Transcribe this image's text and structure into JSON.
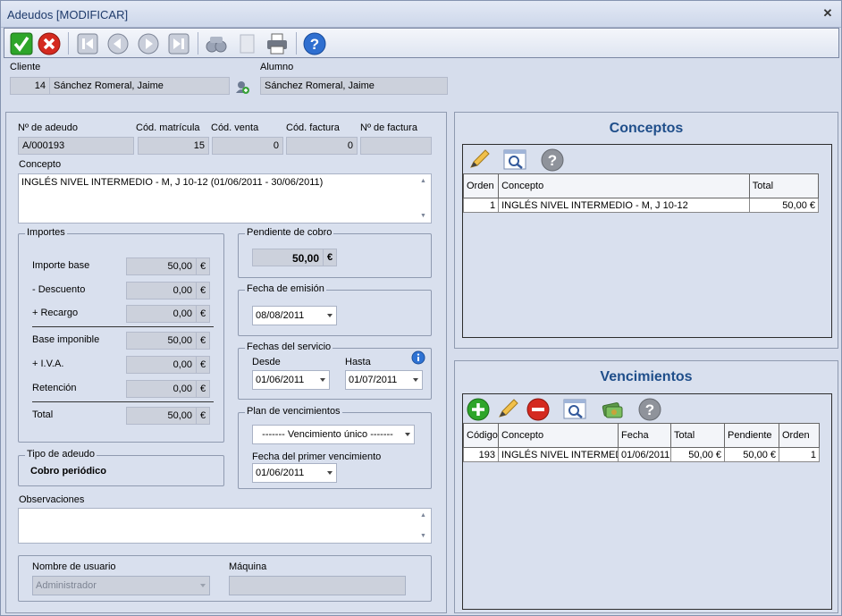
{
  "window": {
    "title": "Adeudos [MODIFICAR]"
  },
  "toolbar": {
    "buttons": [
      "accept-icon",
      "cancel-icon",
      "first-record-icon",
      "previous-record-icon",
      "next-record-icon",
      "last-record-icon",
      "search-binoculars-icon",
      "document-icon",
      "print-icon",
      "help-icon"
    ]
  },
  "cliente": {
    "label": "Cliente",
    "code": "14",
    "name": "Sánchez Romeral, Jaime"
  },
  "alumno": {
    "label": "Alumno",
    "name": "Sánchez Romeral, Jaime"
  },
  "adeudo": {
    "num_label": "Nº de adeudo",
    "num": "A/000193",
    "matricula_label": "Cód. matrícula",
    "matricula": "15",
    "venta_label": "Cód. venta",
    "venta": "0",
    "factura_label": "Cód. factura",
    "factura": "0",
    "nfactura_label": "Nº de factura",
    "nfactura": "",
    "concepto_label": "Concepto",
    "concepto": "INGLÉS NIVEL INTERMEDIO - M, J 10-12 (01/06/2011 - 30/06/2011)"
  },
  "importes": {
    "title": "Importes",
    "currency": "€",
    "rows": [
      {
        "label": "Importe base",
        "value": "50,00"
      },
      {
        "label": "- Descuento",
        "value": "0,00"
      },
      {
        "label": "+ Recargo",
        "value": "0,00"
      },
      {
        "label": "Base imponible",
        "value": "50,00"
      },
      {
        "label": "+ I.V.A.",
        "value": "0,00"
      },
      {
        "label": "Retención",
        "value": "0,00"
      },
      {
        "label": "Total",
        "value": "50,00"
      }
    ]
  },
  "pendiente": {
    "title": "Pendiente de cobro",
    "value": "50,00",
    "currency": "€"
  },
  "emision": {
    "title": "Fecha de emisión",
    "date": "08/08/2011"
  },
  "servicio": {
    "title": "Fechas del servicio",
    "desde_label": "Desde",
    "desde": "01/06/2011",
    "hasta_label": "Hasta",
    "hasta": "01/07/2011"
  },
  "plan": {
    "title": "Plan de vencimientos",
    "selected": "------- Vencimiento único -------",
    "primer_label": "Fecha del primer vencimiento",
    "primer": "01/06/2011"
  },
  "tipo": {
    "title": "Tipo de adeudo",
    "value": "Cobro periódico"
  },
  "observaciones": {
    "label": "Observaciones",
    "value": ""
  },
  "usuario": {
    "user_label": "Nombre de usuario",
    "user": "Administrador",
    "maquina_label": "Máquina",
    "maquina": ""
  },
  "conceptos": {
    "title": "Conceptos",
    "columns": [
      "Orden",
      "Concepto",
      "Total"
    ],
    "rows": [
      {
        "orden": "1",
        "concepto": "INGLÉS NIVEL INTERMEDIO - M, J 10-12",
        "total": "50,00 €"
      }
    ]
  },
  "vencimientos": {
    "title": "Vencimientos",
    "columns": [
      "Código",
      "Concepto",
      "Fecha",
      "Total",
      "Pendiente",
      "Orden"
    ],
    "rows": [
      {
        "codigo": "193",
        "concepto": "INGLÉS NIVEL INTERMEDIO",
        "fecha": "01/06/2011",
        "total": "50,00 €",
        "pendiente": "50,00 €",
        "orden": "1"
      }
    ]
  }
}
